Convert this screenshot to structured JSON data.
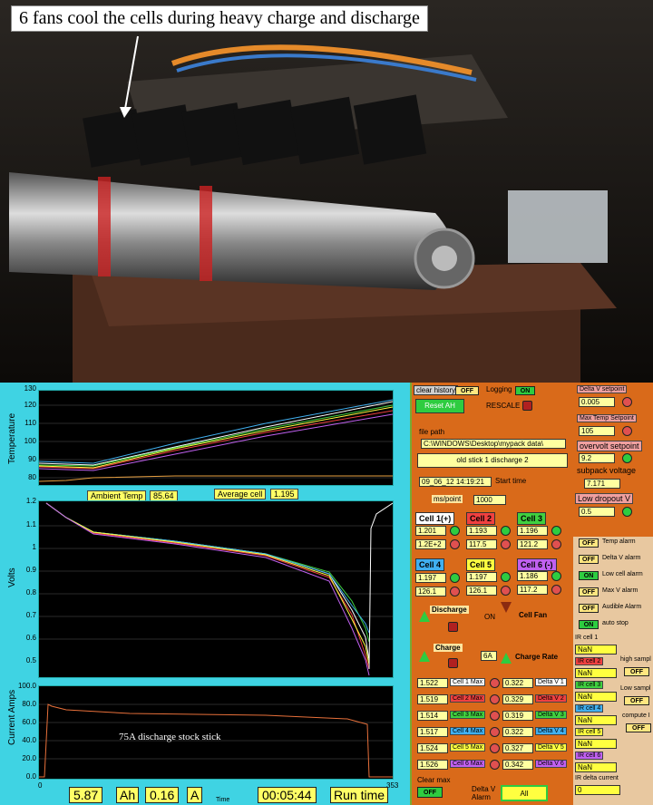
{
  "photo": {
    "caption": "6 fans cool the cells during heavy charge and discharge"
  },
  "temp_chart": {
    "ylabel": "Temperature",
    "ticks": [
      "130",
      "120",
      "110",
      "100",
      "90",
      "80"
    ]
  },
  "volts_chart": {
    "ylabel": "Volts",
    "ticks": [
      "1.2",
      "1.1",
      "1",
      "0.9",
      "0.8",
      "0.7",
      "0.6",
      "0.5"
    ]
  },
  "amps_chart": {
    "ylabel": "Current Amps",
    "ticks": [
      "100.0",
      "80.0",
      "60.0",
      "40.0",
      "20.0",
      "0.0"
    ],
    "annotation": "75A discharge stock stick"
  },
  "readouts": {
    "ambient_label": "Ambient Temp",
    "ambient_value": "85.64",
    "avg_label": "Average cell",
    "avg_value": "1.195",
    "x_start": "0",
    "x_end": "353",
    "x_label": "Time"
  },
  "bottom": {
    "ah_value": "5.87",
    "ah_label": "Ah",
    "a_value": "0.16",
    "a_label": "A",
    "runtime_value": "00:05:44",
    "runtime_label": "Run time"
  },
  "controls": {
    "clear_history": "clear history",
    "clear_history_state": "OFF",
    "logging": "Logging",
    "logging_state": "ON",
    "reset_ah": "Reset AH",
    "rescale": "RESCALE",
    "file_path_label": "file path",
    "file_path": "C:\\WINDOWS\\Desktop\\mypack data\\",
    "file_name": "old stick 1 discharge 2",
    "start_time_value": "09_06_12  14:19:21",
    "start_time_label": "Start time",
    "ms_point_label": "ms/point",
    "ms_point_value": "1000",
    "discharge": "Discharge",
    "discharge_state": "ON",
    "cell_fan": "Cell Fan",
    "charge": "Charge",
    "charge_rate_value": "6A",
    "charge_rate": "Charge Rate",
    "clear_max": "Clear max",
    "clear_max_state": "OFF",
    "delta_v_alarm": "Delta V Alarm",
    "delta_v_alarm_state": "All"
  },
  "cells": [
    {
      "name": "Cell 1(+)",
      "v": "1.201",
      "t": "1.2E+2",
      "color": "#ffffff"
    },
    {
      "name": "Cell 2",
      "v": "1.193",
      "t": "117.5",
      "color": "#f04040"
    },
    {
      "name": "Cell 3",
      "v": "1.196",
      "t": "121.2",
      "color": "#40d040"
    },
    {
      "name": "Cell 4",
      "v": "1.197",
      "t": "126.1",
      "color": "#40b0f0"
    },
    {
      "name": "Cell 5",
      "v": "1.197",
      "t": "126.1",
      "color": "#ffff40"
    },
    {
      "name": "Cell 6 (-)",
      "v": "1.186",
      "t": "117.2",
      "color": "#c060f0"
    }
  ],
  "maxrows": [
    {
      "max": "1.522",
      "label": "Cell 1 Max",
      "dv": "0.322",
      "dlabel": "Delta V 1",
      "color": "#ffffff"
    },
    {
      "max": "1.519",
      "label": "Cell 2 Max",
      "dv": "0.329",
      "dlabel": "Delta V 2",
      "color": "#f04040"
    },
    {
      "max": "1.514",
      "label": "Cell 3 Max",
      "dv": "0.319",
      "dlabel": "Delta V 3",
      "color": "#40d040"
    },
    {
      "max": "1.517",
      "label": "Cell 4 Max",
      "dv": "0.322",
      "dlabel": "Delta V 4",
      "color": "#40b0f0"
    },
    {
      "max": "1.524",
      "label": "Cell 5 Max",
      "dv": "0.327",
      "dlabel": "Delta V 5",
      "color": "#ffff40"
    },
    {
      "max": "1.526",
      "label": "Cell 6 Max",
      "dv": "0.342",
      "dlabel": "Delta V 6",
      "color": "#c060f0"
    }
  ],
  "setpoints": {
    "delta_v_label": "Delta V setpoint",
    "delta_v_value": "0.005",
    "max_temp_label": "Max Temp Setpoint",
    "max_temp_value": "105",
    "overvolt_label": "overvolt setpoint",
    "overvolt_value": "9.2",
    "subpack_label": "subpack voltage",
    "subpack_value": "7.171",
    "low_dropout_label": "Low dropout V",
    "low_dropout_value": "0.5"
  },
  "alarms": [
    {
      "state": "OFF",
      "label": "Temp alarm"
    },
    {
      "state": "OFF",
      "label": "Delta V alarm"
    },
    {
      "state": "ON",
      "label": "Low cell alarm"
    },
    {
      "state": "OFF",
      "label": "Max V alarm"
    },
    {
      "state": "OFF",
      "label": "Audible Alarm"
    },
    {
      "state": "ON",
      "label": "auto stop"
    }
  ],
  "ir": {
    "cells": [
      "IR cell 1",
      "IR cell 2",
      "IR cell 3",
      "IR cell 4",
      "IR cell 5",
      "IR cell 6"
    ],
    "value": "NaN",
    "high_sample": "high sampl",
    "high_state": "OFF",
    "low_sample": "Low sampl",
    "low_state": "OFF",
    "compute": "compute I",
    "compute_state": "OFF",
    "delta_current": "IR delta current",
    "delta_value": "0"
  }
}
